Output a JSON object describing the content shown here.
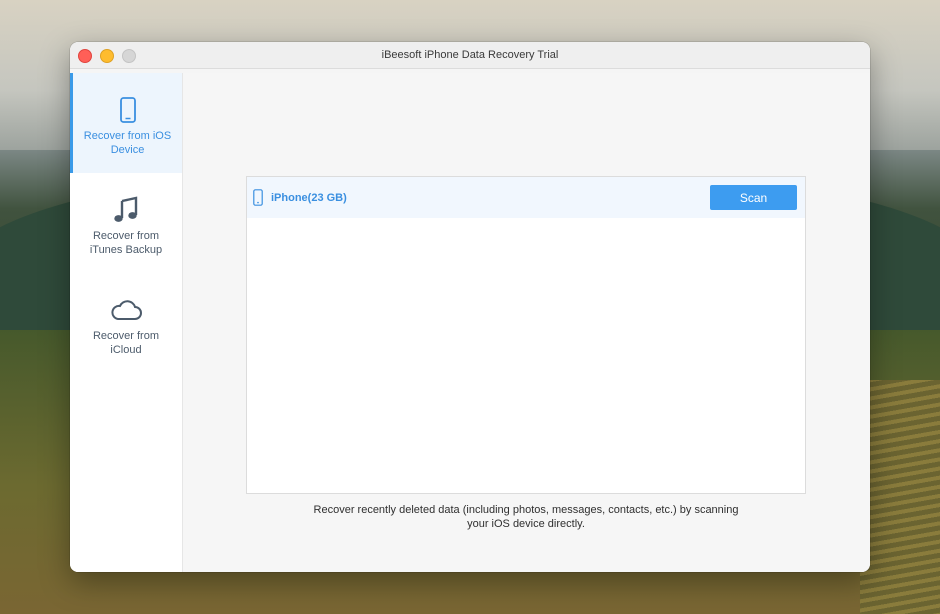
{
  "window": {
    "title": "iBeesoft iPhone Data Recovery Trial"
  },
  "sidebar": {
    "items": [
      {
        "label": "Recover from iOS Device",
        "icon": "iphone-icon",
        "active": true
      },
      {
        "label": "Recover from iTunes Backup",
        "icon": "music-note-icon",
        "active": false
      },
      {
        "label": "Recover from iCloud",
        "icon": "cloud-icon",
        "active": false
      }
    ]
  },
  "device": {
    "name": "iPhone(23 GB)",
    "scan_label": "Scan",
    "icon": "iphone-icon"
  },
  "hint": {
    "line1": "Recover recently deleted data (including photos, messages, contacts, etc.) by scanning",
    "line2": "your iOS device directly."
  },
  "colors": {
    "accent": "#3d9cf0",
    "active_bg": "#edf5fd",
    "inactive_icon": "#4c5b6b"
  }
}
